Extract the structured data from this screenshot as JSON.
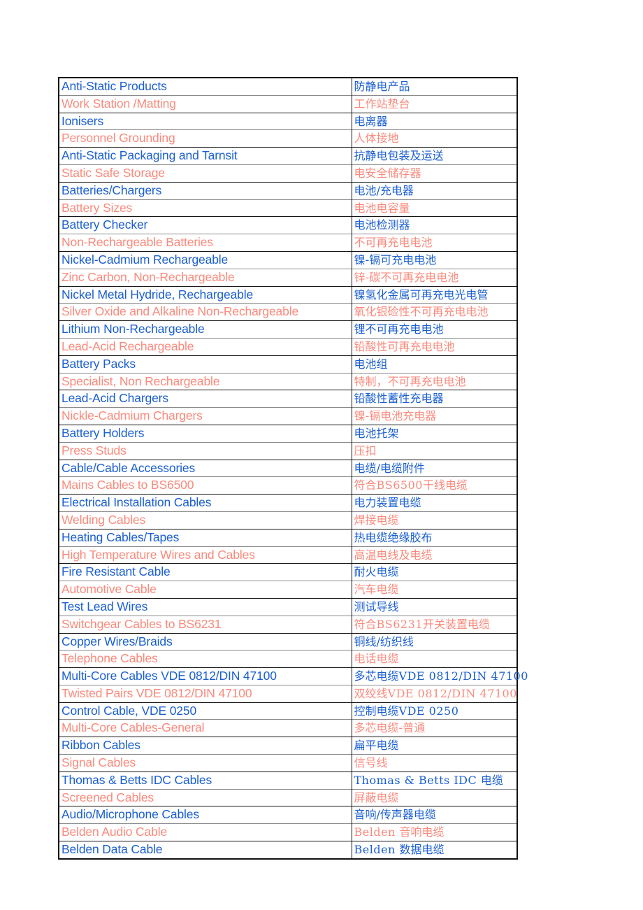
{
  "document": {
    "type": "bilingual-term-table",
    "columns": [
      "English",
      "Chinese"
    ],
    "colors": {
      "blue_text": "#1a5fd0",
      "salmon_text": "#fa8a7c",
      "border_dark": "#141414",
      "border_light": "#8a8a8a",
      "page_background": "#ffffff"
    }
  },
  "rows": [
    {
      "en": "Anti-Static Products",
      "zh": "防静电产品",
      "color": "blue"
    },
    {
      "en": "Work Station /Matting",
      "zh": "工作站垫台",
      "color": "salmon"
    },
    {
      "en": "Ionisers",
      "zh": "电离器",
      "color": "blue"
    },
    {
      "en": "Personnel Grounding",
      "zh": "人体接地",
      "color": "salmon"
    },
    {
      "en": "Anti-Static Packaging and Tarnsit",
      "zh": "抗静电包装及运送",
      "color": "blue"
    },
    {
      "en": "Static Safe Storage",
      "zh": "电安全储存器",
      "color": "salmon"
    },
    {
      "en": "Batteries/Chargers",
      "zh": "电池/充电器",
      "color": "blue"
    },
    {
      "en": "Battery Sizes",
      "zh": "电池电容量",
      "color": "salmon"
    },
    {
      "en": "Battery Checker",
      "zh": "电池检测器",
      "color": "blue"
    },
    {
      "en": "Non-Rechargeable Batteries",
      "zh": "不可再充电电池",
      "color": "salmon"
    },
    {
      "en": "Nickel-Cadmium Rechargeable",
      "zh": "镍-镉可充电电池",
      "color": "blue"
    },
    {
      "en": "Zinc Carbon, Non-Rechargeable",
      "zh": "锌-碳不可再充电电池",
      "color": "salmon"
    },
    {
      "en": "Nickel Metal Hydride, Rechargeable",
      "zh": "镍氢化金属可再充电光电管",
      "color": "blue"
    },
    {
      "en": "Silver Oxide and Alkaline Non-Rechargeable",
      "zh": "氧化银硷性不可再充电电池",
      "color": "salmon"
    },
    {
      "en": "Lithium Non-Rechargeable",
      "zh": "锂不可再充电电池",
      "color": "blue"
    },
    {
      "en": "Lead-Acid Rechargeable",
      "zh": "铅酸性可再充电电池",
      "color": "salmon"
    },
    {
      "en": "Battery Packs",
      "zh": "电池组",
      "color": "blue"
    },
    {
      "en": "Specialist, Non Rechargeable",
      "zh": "特制，不可再充电电池",
      "color": "salmon"
    },
    {
      "en": "Lead-Acid Chargers",
      "zh": "铅酸性蓄性充电器",
      "color": "blue"
    },
    {
      "en": "Nickle-Cadmium Chargers",
      "zh": "镍-镉电池充电器",
      "color": "salmon"
    },
    {
      "en": "Battery Holders",
      "zh": "电池托架",
      "color": "blue"
    },
    {
      "en": "Press Studs",
      "zh": "压扣",
      "color": "salmon"
    },
    {
      "en": "Cable/Cable Accessories",
      "zh": "电缆/电缆附件",
      "color": "blue"
    },
    {
      "en": "Mains Cables to BS6500",
      "zh": "符合BS6500干线电缆",
      "color": "salmon"
    },
    {
      "en": "Electrical Installation Cables",
      "zh": "电力装置电缆",
      "color": "blue"
    },
    {
      "en": "Welding Cables",
      "zh": "焊接电缆",
      "color": "salmon"
    },
    {
      "en": "Heating Cables/Tapes",
      "zh": "热电缆绝缘胶布",
      "color": "blue"
    },
    {
      "en": "High Temperature Wires and Cables",
      "zh": "高温电线及电缆",
      "color": "salmon"
    },
    {
      "en": "Fire Resistant Cable",
      "zh": "耐火电缆",
      "color": "blue"
    },
    {
      "en": "Automotive Cable",
      "zh": "汽车电缆",
      "color": "salmon"
    },
    {
      "en": "Test Lead Wires",
      "zh": "测试导线",
      "color": "blue"
    },
    {
      "en": "Switchgear Cables to BS6231",
      "zh": "符合BS6231开关装置电缆",
      "color": "salmon"
    },
    {
      "en": "Copper Wires/Braids",
      "zh": "铜线/纺织线",
      "color": "blue"
    },
    {
      "en": "Telephone Cables",
      "zh": "电话电缆",
      "color": "salmon"
    },
    {
      "en": "Multi-Core Cables VDE 0812/DIN 47100",
      "zh": "多芯电缆VDE 0812/DIN 47100",
      "color": "blue"
    },
    {
      "en": "Twisted Pairs VDE 0812/DIN 47100",
      "zh": "双绞线VDE 0812/DIN 47100",
      "color": "salmon"
    },
    {
      "en": "Control Cable, VDE 0250",
      "zh": "控制电缆VDE 0250",
      "color": "blue"
    },
    {
      "en": "Multi-Core Cables-General",
      "zh": "多芯电缆-普通",
      "color": "salmon"
    },
    {
      "en": "Ribbon Cables",
      "zh": "扁平电缆",
      "color": "blue"
    },
    {
      "en": "Signal Cables",
      "zh": "信号线",
      "color": "salmon"
    },
    {
      "en": "Thomas & Betts IDC Cables",
      "zh": "Thomas & Betts IDC 电缆",
      "color": "blue"
    },
    {
      "en": "Screened Cables",
      "zh": "屏蔽电缆",
      "color": "salmon"
    },
    {
      "en": "Audio/Microphone Cables",
      "zh": "音响/传声器电缆",
      "color": "blue"
    },
    {
      "en": "Belden Audio Cable",
      "zh": "Belden 音响电缆",
      "color": "salmon"
    },
    {
      "en": "Belden Data Cable",
      "zh": "Belden 数据电缆",
      "color": "blue"
    }
  ]
}
